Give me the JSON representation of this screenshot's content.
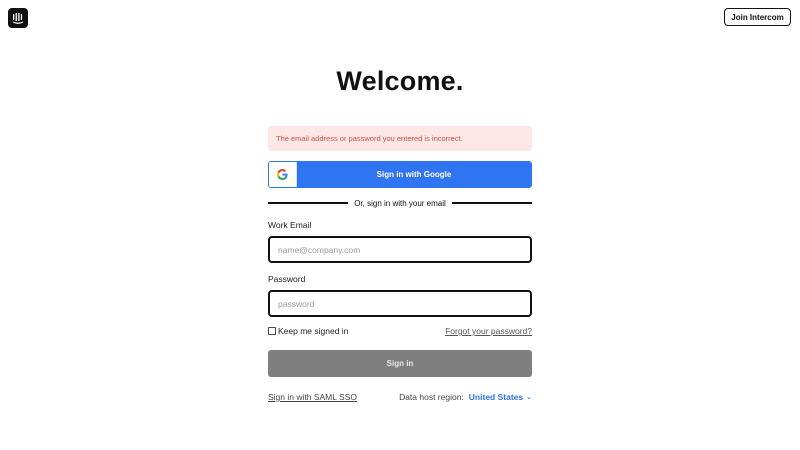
{
  "header": {
    "logo_name": "intercom-logo",
    "join_label": "Join Intercom"
  },
  "title": "Welcome.",
  "error_message": "The email address or password you entered is incorrect.",
  "google_button": {
    "label": "Sign in with Google",
    "icon": "google-icon"
  },
  "divider_text": "Or, sign in with your email",
  "email": {
    "label": "Work Email",
    "placeholder": "name@company.com",
    "value": ""
  },
  "password": {
    "label": "Password",
    "placeholder": "password",
    "value": ""
  },
  "keep_signed_in": {
    "label": "Keep me signed in",
    "checked": false
  },
  "forgot_label": "Forgot your password?",
  "signin_label": "Sign in",
  "saml_label": "Sign in with SAML SSO",
  "region": {
    "label": "Data host region:",
    "value": "United States"
  },
  "colors": {
    "accent": "#2f74f0",
    "error_bg": "#fde7e7",
    "error_text": "#d34d4d",
    "disabled_button": "#7f7f7f"
  }
}
